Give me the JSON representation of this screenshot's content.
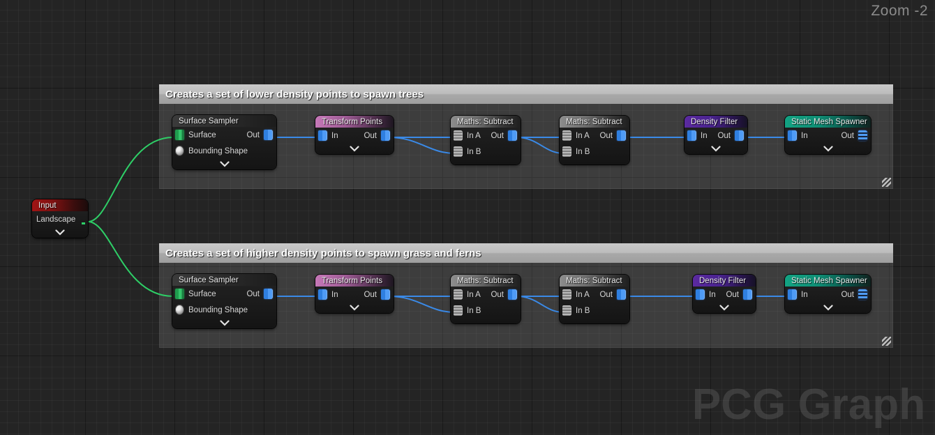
{
  "app": {
    "zoom_label": "Zoom -2",
    "watermark": "PCG Graph",
    "accent_blue": "#4f9bf5",
    "accent_green": "#2ecf67",
    "bg": "#242424"
  },
  "comments": [
    {
      "title": "Creates a set of lower density points to spawn trees"
    },
    {
      "title": "Creates a set of higher density points to spawn grass and ferns"
    }
  ],
  "input_node": {
    "title": "Input",
    "pins": [
      {
        "label": "Landscape"
      }
    ]
  },
  "rows": [
    {
      "nodes": [
        {
          "title": "Surface Sampler",
          "inputs": [
            {
              "label": "Surface",
              "pin": "green-bars"
            },
            {
              "label": "Bounding Shape",
              "pin": "grey-sphere"
            }
          ],
          "outputs": [
            {
              "label": "Out",
              "pin": "blue"
            }
          ]
        },
        {
          "title": "Transform Points",
          "inputs": [
            {
              "label": "In",
              "pin": "blue"
            }
          ],
          "outputs": [
            {
              "label": "Out",
              "pin": "blue"
            }
          ]
        },
        {
          "title": "Maths: Subtract",
          "inputs": [
            {
              "label": "In A",
              "pin": "grey"
            },
            {
              "label": "In B",
              "pin": "grey"
            }
          ],
          "outputs": [
            {
              "label": "Out",
              "pin": "blue"
            }
          ]
        },
        {
          "title": "Maths: Subtract",
          "inputs": [
            {
              "label": "In A",
              "pin": "grey"
            },
            {
              "label": "In B",
              "pin": "grey"
            }
          ],
          "outputs": [
            {
              "label": "Out",
              "pin": "blue"
            }
          ]
        },
        {
          "title": "Density Filter",
          "inputs": [
            {
              "label": "In",
              "pin": "blue"
            }
          ],
          "outputs": [
            {
              "label": "Out",
              "pin": "blue"
            }
          ]
        },
        {
          "title": "Static Mesh Spawner",
          "inputs": [
            {
              "label": "In",
              "pin": "blue"
            }
          ],
          "outputs": [
            {
              "label": "Out",
              "pin": "blue-stack"
            }
          ]
        }
      ]
    },
    {
      "nodes": [
        {
          "title": "Surface Sampler",
          "inputs": [
            {
              "label": "Surface",
              "pin": "green-bars"
            },
            {
              "label": "Bounding Shape",
              "pin": "grey-sphere"
            }
          ],
          "outputs": [
            {
              "label": "Out",
              "pin": "blue"
            }
          ]
        },
        {
          "title": "Transform Points",
          "inputs": [
            {
              "label": "In",
              "pin": "blue"
            }
          ],
          "outputs": [
            {
              "label": "Out",
              "pin": "blue"
            }
          ]
        },
        {
          "title": "Maths: Subtract",
          "inputs": [
            {
              "label": "In A",
              "pin": "grey"
            },
            {
              "label": "In B",
              "pin": "grey"
            }
          ],
          "outputs": [
            {
              "label": "Out",
              "pin": "blue"
            }
          ]
        },
        {
          "title": "Maths: Subtract",
          "inputs": [
            {
              "label": "In A",
              "pin": "grey"
            },
            {
              "label": "In B",
              "pin": "grey"
            }
          ],
          "outputs": [
            {
              "label": "Out",
              "pin": "blue"
            }
          ]
        },
        {
          "title": "Density Filter",
          "inputs": [
            {
              "label": "In",
              "pin": "blue"
            }
          ],
          "outputs": [
            {
              "label": "Out",
              "pin": "blue"
            }
          ]
        },
        {
          "title": "Static Mesh Spawner",
          "inputs": [
            {
              "label": "In",
              "pin": "blue"
            }
          ],
          "outputs": [
            {
              "label": "Out",
              "pin": "blue-stack"
            }
          ]
        }
      ]
    }
  ]
}
